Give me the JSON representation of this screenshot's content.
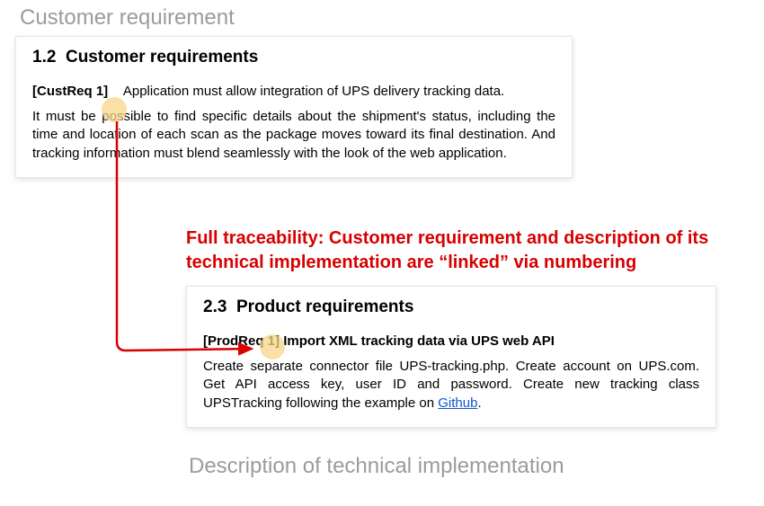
{
  "captions": {
    "top": "Customer requirement",
    "bottom": "Description of technical implementation"
  },
  "card1": {
    "title": "1.2  Customer requirements",
    "req_label": "[CustReq 1]",
    "req_text": "Application must allow integration of UPS delivery tracking data.",
    "body": "It must be possible to find specific details about the shipment's status, including the time and location of each scan as the package moves toward its final destination. And tracking information must blend seamlessly with the look of the web application."
  },
  "callout": {
    "text": "Full traceability: Customer requirement and description of its technical implementation are “linked” via numbering"
  },
  "card2": {
    "title": "2.3  Product requirements",
    "req_label_prefix": "[ProdReq 1] ",
    "req_title": "Import XML tracking data via UPS web API",
    "body_before_link": "Create separate connector file UPS-tracking.php. Create account on UPS.com. Get API access key, user ID and password. Create new tracking class UPSTracking following the example on ",
    "link_text": "Github",
    "body_after_link": "."
  },
  "colors": {
    "accent_red": "#d80000",
    "highlight": "#f8d68a",
    "caption_gray": "#9b9b9b",
    "link_blue": "#1155cc"
  }
}
